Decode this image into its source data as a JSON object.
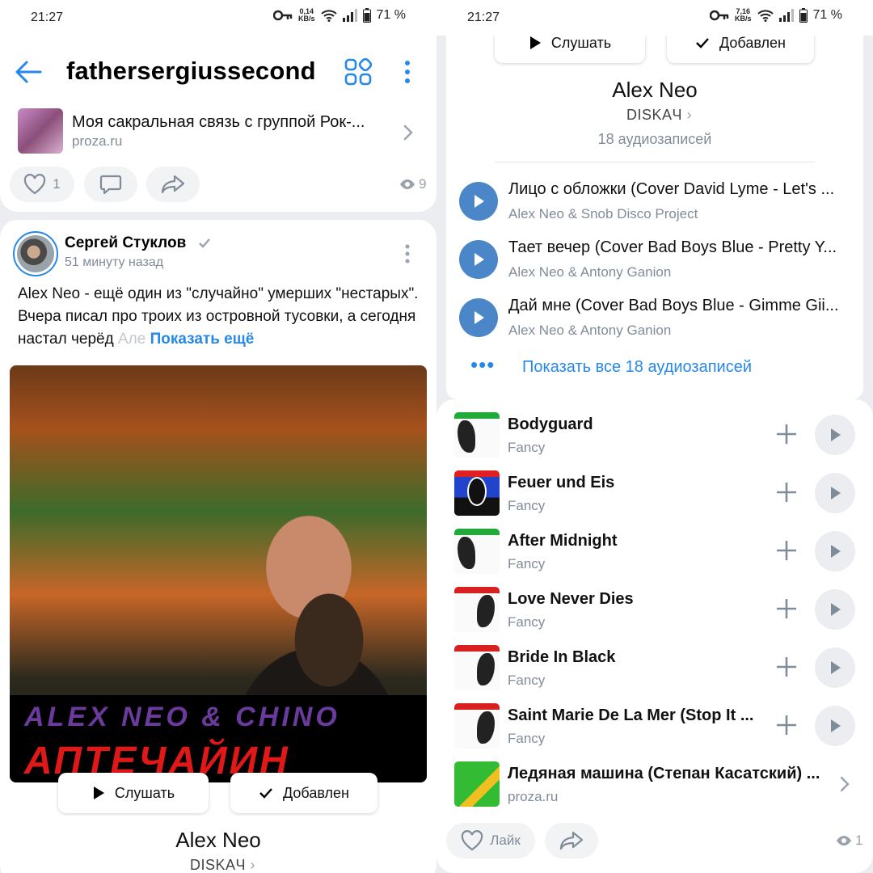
{
  "status_left": {
    "time": "21:27",
    "speed": "0,14",
    "speed_unit": "KB/s",
    "battery": "71 %"
  },
  "status_right": {
    "time": "21:27",
    "speed": "7,16",
    "speed_unit": "KB/s",
    "battery": "71 %"
  },
  "header": {
    "title": "fathersergiussecond"
  },
  "link_card": {
    "title": "Моя сакральная связь с группой Рок-...",
    "domain": "proza.ru"
  },
  "post1_actions": {
    "likes": "1",
    "views": "9"
  },
  "post2": {
    "author": "Сергей Стуклов",
    "time": "51 минуту назад",
    "text_main": "Alex Neo - ещё один из \"случайно\" умерших \"нестарых\". Вчера писал про троих из островной тусовки, а сегодня настал черёд ",
    "text_fade": "Але",
    "show_more": "Показать ещё"
  },
  "cover": {
    "line1": "ALEX NEO & CHINO",
    "line2": "АПТЕЧАЙИН"
  },
  "album": {
    "listen_label": "Слушать",
    "added_label": "Добавлен",
    "title": "Alex Neo",
    "artist": "DISKAЧ",
    "count": "18 аудиозаписей",
    "tracks": [
      {
        "title": "Лицо с обложки (Cover David Lyme - Let's ...",
        "artist": "Alex Neo & Snob Disco Project"
      },
      {
        "title": "Тает вечер (Cover Bad Boys Blue - Pretty Y...",
        "artist": "Alex Neo & Antony Ganion"
      },
      {
        "title": "Дай мне (Cover Bad Boys Blue - Gimme Gii...",
        "artist": "Alex Neo & Antony Ganion"
      }
    ],
    "show_all": "Показать все 18 аудиозаписей"
  },
  "songs": [
    {
      "title": "Bodyguard",
      "artist": "Fancy",
      "accent": "#1faa3a"
    },
    {
      "title": "Feuer und Eis",
      "artist": "Fancy",
      "accent": "#2255cc"
    },
    {
      "title": "After Midnight",
      "artist": "Fancy",
      "accent": "#1faa3a"
    },
    {
      "title": "Love Never Dies",
      "artist": "Fancy",
      "accent": "#d92020"
    },
    {
      "title": "Bride In Black",
      "artist": "Fancy",
      "accent": "#d92020"
    },
    {
      "title": "Saint Marie De La Mer (Stop It ...",
      "artist": "Fancy",
      "accent": "#d92020"
    }
  ],
  "link_card2": {
    "title": "Ледяная машина (Степан Касатский) ...",
    "domain": "proza.ru"
  },
  "post3_actions": {
    "like_label": "Лайк",
    "views": "1"
  },
  "colors": {
    "accent": "#2688eb",
    "play": "#4a86c8",
    "secondary": "#818c99"
  }
}
